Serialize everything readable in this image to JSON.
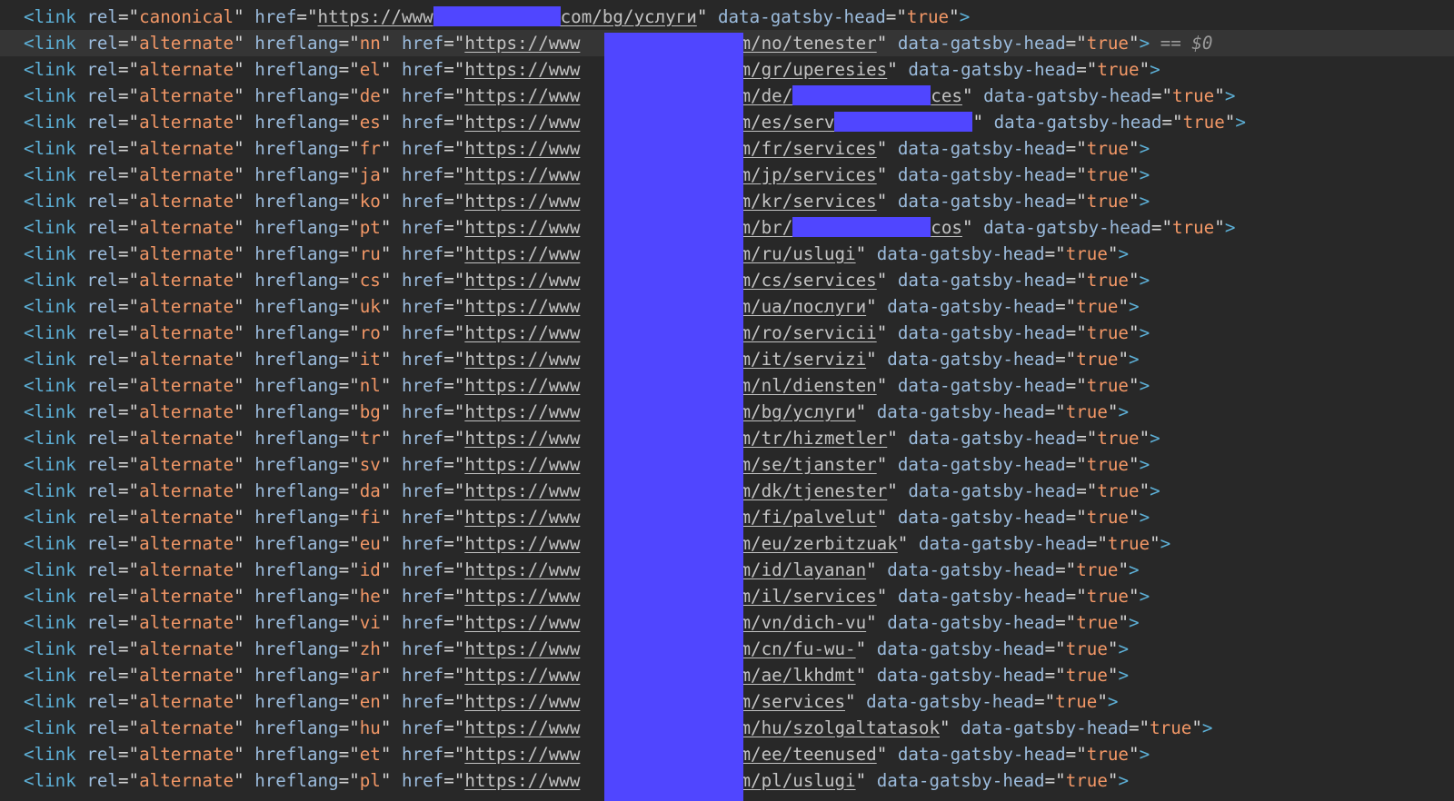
{
  "tokens": {
    "open_tag": "<link",
    "close_tag": ">",
    "rel_attr": "rel",
    "hreflang_attr": "hreflang",
    "href_attr": "href",
    "gatsby_attr": "data-gatsby-head",
    "gatsby_value": "true",
    "url_prefix": "https://www",
    "equals": "=",
    "quote": "\""
  },
  "canonical": {
    "rel": "canonical",
    "path": "com/bg/услуги"
  },
  "console_ref": "== $0",
  "colors": {
    "background": "#282828",
    "selected_line": "#353535",
    "tag": "#5db0d7",
    "attribute": "#9bbbdc",
    "value": "#f29766",
    "redaction": "#5046ff"
  },
  "alternates": [
    {
      "rel": "alternate",
      "hreflang": "nn",
      "path": "com/no/tenester",
      "selected": true
    },
    {
      "rel": "alternate",
      "hreflang": "el",
      "path": "com/gr/uperesies"
    },
    {
      "rel": "alternate",
      "hreflang": "de",
      "path": "com/de/",
      "path_tail": "ces",
      "redacted_segment": true
    },
    {
      "rel": "alternate",
      "hreflang": "es",
      "path": "com/es/serv",
      "path_tail": "",
      "redacted_segment": true
    },
    {
      "rel": "alternate",
      "hreflang": "fr",
      "path": "com/fr/services"
    },
    {
      "rel": "alternate",
      "hreflang": "ja",
      "path": "com/jp/services"
    },
    {
      "rel": "alternate",
      "hreflang": "ko",
      "path": "com/kr/services"
    },
    {
      "rel": "alternate",
      "hreflang": "pt",
      "path": "com/br/",
      "path_tail": "cos",
      "redacted_segment": true
    },
    {
      "rel": "alternate",
      "hreflang": "ru",
      "path": "com/ru/uslugi"
    },
    {
      "rel": "alternate",
      "hreflang": "cs",
      "path": "com/cs/services"
    },
    {
      "rel": "alternate",
      "hreflang": "uk",
      "path": "com/ua/послуги"
    },
    {
      "rel": "alternate",
      "hreflang": "ro",
      "path": "com/ro/servicii"
    },
    {
      "rel": "alternate",
      "hreflang": "it",
      "path": "com/it/servizi"
    },
    {
      "rel": "alternate",
      "hreflang": "nl",
      "path": "com/nl/diensten"
    },
    {
      "rel": "alternate",
      "hreflang": "bg",
      "path": "com/bg/услуги"
    },
    {
      "rel": "alternate",
      "hreflang": "tr",
      "path": "com/tr/hizmetler"
    },
    {
      "rel": "alternate",
      "hreflang": "sv",
      "path": "com/se/tjanster"
    },
    {
      "rel": "alternate",
      "hreflang": "da",
      "path": "com/dk/tjenester"
    },
    {
      "rel": "alternate",
      "hreflang": "fi",
      "path": "com/fi/palvelut"
    },
    {
      "rel": "alternate",
      "hreflang": "eu",
      "path": "com/eu/zerbitzuak"
    },
    {
      "rel": "alternate",
      "hreflang": "id",
      "path": "com/id/layanan"
    },
    {
      "rel": "alternate",
      "hreflang": "he",
      "path": "com/il/services"
    },
    {
      "rel": "alternate",
      "hreflang": "vi",
      "path": "com/vn/dich-vu"
    },
    {
      "rel": "alternate",
      "hreflang": "zh",
      "path": "com/cn/fu-wu-"
    },
    {
      "rel": "alternate",
      "hreflang": "ar",
      "path": "com/ae/lkhdmt"
    },
    {
      "rel": "alternate",
      "hreflang": "en",
      "path": "com/services"
    },
    {
      "rel": "alternate",
      "hreflang": "hu",
      "path": "com/hu/szolgaltatasok"
    },
    {
      "rel": "alternate",
      "hreflang": "et",
      "path": "com/ee/teenused"
    },
    {
      "rel": "alternate",
      "hreflang": "pl",
      "path": "com/pl/uslugi"
    }
  ]
}
